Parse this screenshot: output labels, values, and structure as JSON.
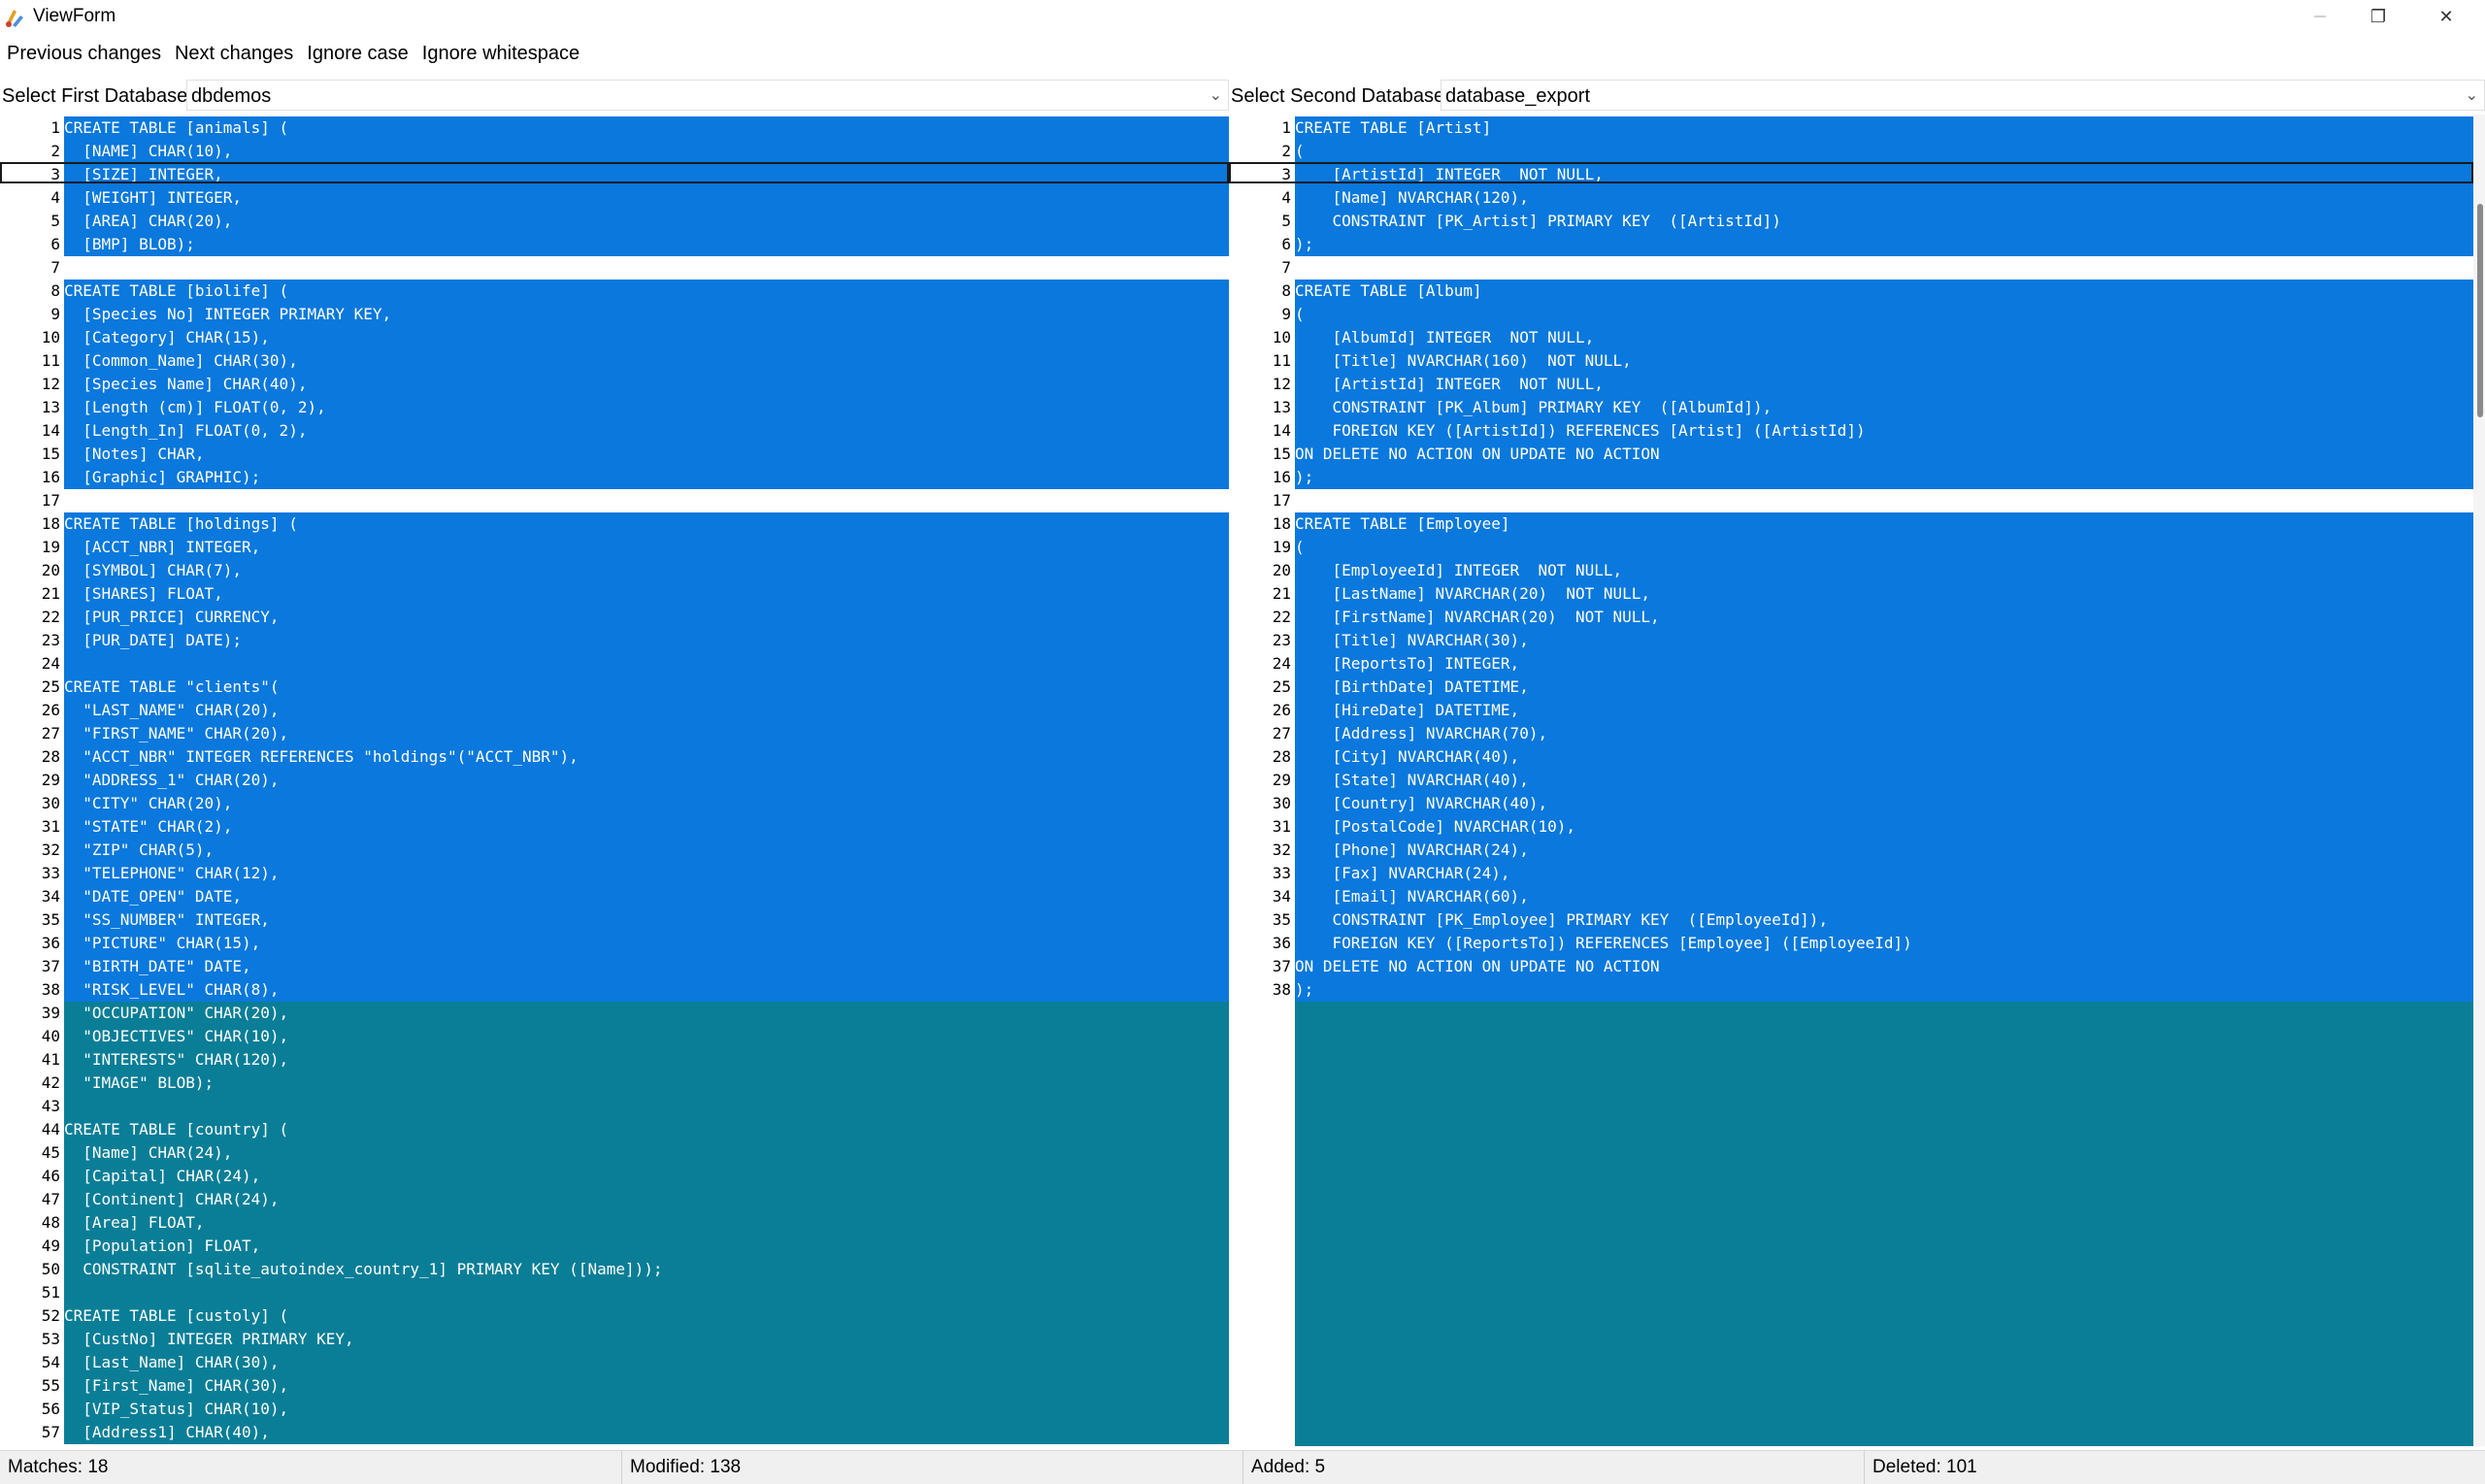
{
  "window": {
    "title": "ViewForm",
    "restore_glyph": "❐",
    "close_glyph": "✕"
  },
  "menu": [
    "Previous changes",
    "Next changes",
    "Ignore case",
    "Ignore whitespace"
  ],
  "selectors": {
    "first": {
      "label": "Select First Database:",
      "value": "dbdemos"
    },
    "second": {
      "label": "Select Second Database:",
      "value": "database_export"
    }
  },
  "colors": {
    "modified": "#0a78dc",
    "deleted": "#0a7e97",
    "equal": "#ffffff"
  },
  "left_lines": [
    {
      "n": "1",
      "t": "CREATE TABLE [animals] (",
      "s": "mod"
    },
    {
      "n": "2",
      "t": "  [NAME] CHAR(10),",
      "s": "mod"
    },
    {
      "n": "3",
      "t": "  [SIZE] INTEGER,",
      "s": "mod"
    },
    {
      "n": "4",
      "t": "  [WEIGHT] INTEGER,",
      "s": "mod"
    },
    {
      "n": "5",
      "t": "  [AREA] CHAR(20),",
      "s": "mod"
    },
    {
      "n": "6",
      "t": "  [BMP] BLOB);",
      "s": "mod"
    },
    {
      "n": "7",
      "t": "",
      "s": "eq"
    },
    {
      "n": "8",
      "t": "CREATE TABLE [biolife] (",
      "s": "mod"
    },
    {
      "n": "9",
      "t": "  [Species No] INTEGER PRIMARY KEY,",
      "s": "mod"
    },
    {
      "n": "10",
      "t": "  [Category] CHAR(15),",
      "s": "mod"
    },
    {
      "n": "11",
      "t": "  [Common_Name] CHAR(30),",
      "s": "mod"
    },
    {
      "n": "12",
      "t": "  [Species Name] CHAR(40),",
      "s": "mod"
    },
    {
      "n": "13",
      "t": "  [Length (cm)] FLOAT(0, 2),",
      "s": "mod"
    },
    {
      "n": "14",
      "t": "  [Length_In] FLOAT(0, 2),",
      "s": "mod"
    },
    {
      "n": "15",
      "t": "  [Notes] CHAR,",
      "s": "mod"
    },
    {
      "n": "16",
      "t": "  [Graphic] GRAPHIC);",
      "s": "mod"
    },
    {
      "n": "17",
      "t": "",
      "s": "eq"
    },
    {
      "n": "18",
      "t": "CREATE TABLE [holdings] (",
      "s": "mod"
    },
    {
      "n": "19",
      "t": "  [ACCT_NBR] INTEGER,",
      "s": "mod"
    },
    {
      "n": "20",
      "t": "  [SYMBOL] CHAR(7),",
      "s": "mod"
    },
    {
      "n": "21",
      "t": "  [SHARES] FLOAT,",
      "s": "mod"
    },
    {
      "n": "22",
      "t": "  [PUR_PRICE] CURRENCY,",
      "s": "mod"
    },
    {
      "n": "23",
      "t": "  [PUR_DATE] DATE);",
      "s": "mod"
    },
    {
      "n": "24",
      "t": "",
      "s": "mod"
    },
    {
      "n": "25",
      "t": "CREATE TABLE \"clients\"(",
      "s": "mod"
    },
    {
      "n": "26",
      "t": "  \"LAST_NAME\" CHAR(20),",
      "s": "mod"
    },
    {
      "n": "27",
      "t": "  \"FIRST_NAME\" CHAR(20),",
      "s": "mod"
    },
    {
      "n": "28",
      "t": "  \"ACCT_NBR\" INTEGER REFERENCES \"holdings\"(\"ACCT_NBR\"),",
      "s": "mod"
    },
    {
      "n": "29",
      "t": "  \"ADDRESS_1\" CHAR(20),",
      "s": "mod"
    },
    {
      "n": "30",
      "t": "  \"CITY\" CHAR(20),",
      "s": "mod"
    },
    {
      "n": "31",
      "t": "  \"STATE\" CHAR(2),",
      "s": "mod"
    },
    {
      "n": "32",
      "t": "  \"ZIP\" CHAR(5),",
      "s": "mod"
    },
    {
      "n": "33",
      "t": "  \"TELEPHONE\" CHAR(12),",
      "s": "mod"
    },
    {
      "n": "34",
      "t": "  \"DATE_OPEN\" DATE,",
      "s": "mod"
    },
    {
      "n": "35",
      "t": "  \"SS_NUMBER\" INTEGER,",
      "s": "mod"
    },
    {
      "n": "36",
      "t": "  \"PICTURE\" CHAR(15),",
      "s": "mod"
    },
    {
      "n": "37",
      "t": "  \"BIRTH_DATE\" DATE,",
      "s": "mod"
    },
    {
      "n": "38",
      "t": "  \"RISK_LEVEL\" CHAR(8),",
      "s": "mod"
    },
    {
      "n": "39",
      "t": "  \"OCCUPATION\" CHAR(20),",
      "s": "del"
    },
    {
      "n": "40",
      "t": "  \"OBJECTIVES\" CHAR(10),",
      "s": "del"
    },
    {
      "n": "41",
      "t": "  \"INTERESTS\" CHAR(120),",
      "s": "del"
    },
    {
      "n": "42",
      "t": "  \"IMAGE\" BLOB);",
      "s": "del"
    },
    {
      "n": "43",
      "t": "",
      "s": "del"
    },
    {
      "n": "44",
      "t": "CREATE TABLE [country] (",
      "s": "del"
    },
    {
      "n": "45",
      "t": "  [Name] CHAR(24),",
      "s": "del"
    },
    {
      "n": "46",
      "t": "  [Capital] CHAR(24),",
      "s": "del"
    },
    {
      "n": "47",
      "t": "  [Continent] CHAR(24),",
      "s": "del"
    },
    {
      "n": "48",
      "t": "  [Area] FLOAT,",
      "s": "del"
    },
    {
      "n": "49",
      "t": "  [Population] FLOAT,",
      "s": "del"
    },
    {
      "n": "50",
      "t": "  CONSTRAINT [sqlite_autoindex_country_1] PRIMARY KEY ([Name]));",
      "s": "del"
    },
    {
      "n": "51",
      "t": "",
      "s": "del"
    },
    {
      "n": "52",
      "t": "CREATE TABLE [custoly] (",
      "s": "del"
    },
    {
      "n": "53",
      "t": "  [CustNo] INTEGER PRIMARY KEY,",
      "s": "del"
    },
    {
      "n": "54",
      "t": "  [Last_Name] CHAR(30),",
      "s": "del"
    },
    {
      "n": "55",
      "t": "  [First_Name] CHAR(30),",
      "s": "del"
    },
    {
      "n": "56",
      "t": "  [VIP_Status] CHAR(10),",
      "s": "del"
    },
    {
      "n": "57",
      "t": "  [Address1] CHAR(40),",
      "s": "del"
    }
  ],
  "right_lines": [
    {
      "n": "1",
      "t": "CREATE TABLE [Artist]",
      "s": "mod"
    },
    {
      "n": "2",
      "t": "(",
      "s": "mod"
    },
    {
      "n": "3",
      "t": "    [ArtistId] INTEGER  NOT NULL,",
      "s": "mod"
    },
    {
      "n": "4",
      "t": "    [Name] NVARCHAR(120),",
      "s": "mod"
    },
    {
      "n": "5",
      "t": "    CONSTRAINT [PK_Artist] PRIMARY KEY  ([ArtistId])",
      "s": "mod"
    },
    {
      "n": "6",
      "t": ");",
      "s": "mod"
    },
    {
      "n": "7",
      "t": "",
      "s": "eq"
    },
    {
      "n": "8",
      "t": "CREATE TABLE [Album]",
      "s": "mod"
    },
    {
      "n": "9",
      "t": "(",
      "s": "mod"
    },
    {
      "n": "10",
      "t": "    [AlbumId] INTEGER  NOT NULL,",
      "s": "mod"
    },
    {
      "n": "11",
      "t": "    [Title] NVARCHAR(160)  NOT NULL,",
      "s": "mod"
    },
    {
      "n": "12",
      "t": "    [ArtistId] INTEGER  NOT NULL,",
      "s": "mod"
    },
    {
      "n": "13",
      "t": "    CONSTRAINT [PK_Album] PRIMARY KEY  ([AlbumId]),",
      "s": "mod"
    },
    {
      "n": "14",
      "t": "    FOREIGN KEY ([ArtistId]) REFERENCES [Artist] ([ArtistId])",
      "s": "mod"
    },
    {
      "n": "15",
      "t": "ON DELETE NO ACTION ON UPDATE NO ACTION",
      "s": "mod"
    },
    {
      "n": "16",
      "t": ");",
      "s": "mod"
    },
    {
      "n": "17",
      "t": "",
      "s": "eq"
    },
    {
      "n": "18",
      "t": "CREATE TABLE [Employee]",
      "s": "mod"
    },
    {
      "n": "19",
      "t": "(",
      "s": "mod"
    },
    {
      "n": "20",
      "t": "    [EmployeeId] INTEGER  NOT NULL,",
      "s": "mod"
    },
    {
      "n": "21",
      "t": "    [LastName] NVARCHAR(20)  NOT NULL,",
      "s": "mod"
    },
    {
      "n": "22",
      "t": "    [FirstName] NVARCHAR(20)  NOT NULL,",
      "s": "mod"
    },
    {
      "n": "23",
      "t": "    [Title] NVARCHAR(30),",
      "s": "mod"
    },
    {
      "n": "24",
      "t": "    [ReportsTo] INTEGER,",
      "s": "mod"
    },
    {
      "n": "25",
      "t": "    [BirthDate] DATETIME,",
      "s": "mod"
    },
    {
      "n": "26",
      "t": "    [HireDate] DATETIME,",
      "s": "mod"
    },
    {
      "n": "27",
      "t": "    [Address] NVARCHAR(70),",
      "s": "mod"
    },
    {
      "n": "28",
      "t": "    [City] NVARCHAR(40),",
      "s": "mod"
    },
    {
      "n": "29",
      "t": "    [State] NVARCHAR(40),",
      "s": "mod"
    },
    {
      "n": "30",
      "t": "    [Country] NVARCHAR(40),",
      "s": "mod"
    },
    {
      "n": "31",
      "t": "    [PostalCode] NVARCHAR(10),",
      "s": "mod"
    },
    {
      "n": "32",
      "t": "    [Phone] NVARCHAR(24),",
      "s": "mod"
    },
    {
      "n": "33",
      "t": "    [Fax] NVARCHAR(24),",
      "s": "mod"
    },
    {
      "n": "34",
      "t": "    [Email] NVARCHAR(60),",
      "s": "mod"
    },
    {
      "n": "35",
      "t": "    CONSTRAINT [PK_Employee] PRIMARY KEY  ([EmployeeId]),",
      "s": "mod"
    },
    {
      "n": "36",
      "t": "    FOREIGN KEY ([ReportsTo]) REFERENCES [Employee] ([EmployeeId])",
      "s": "mod"
    },
    {
      "n": "37",
      "t": "ON DELETE NO ACTION ON UPDATE NO ACTION",
      "s": "mod"
    },
    {
      "n": "38",
      "t": ");",
      "s": "mod"
    }
  ],
  "status": {
    "matches": "Matches: 18",
    "modified": "Modified: 138",
    "added": "Added: 5",
    "deleted": "Deleted: 101"
  }
}
